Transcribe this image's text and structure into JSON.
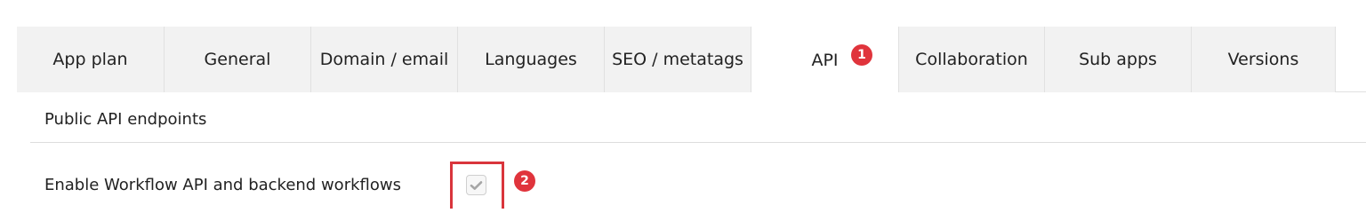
{
  "tabs": [
    {
      "label": "App plan",
      "active": false
    },
    {
      "label": "General",
      "active": false
    },
    {
      "label": "Domain / email",
      "active": false
    },
    {
      "label": "Languages",
      "active": false
    },
    {
      "label": "SEO / metatags",
      "active": false
    },
    {
      "label": "API",
      "active": true
    },
    {
      "label": "Collaboration",
      "active": false
    },
    {
      "label": "Sub apps",
      "active": false
    },
    {
      "label": "Versions",
      "active": false
    }
  ],
  "annotations": {
    "step1": "1",
    "step2": "2"
  },
  "section": {
    "title": "Public API endpoints"
  },
  "settings": {
    "workflow_api_label": "Enable Workflow API and backend workflows",
    "workflow_api_checked": true
  },
  "colors": {
    "tab_inactive_bg": "#f2f2f2",
    "tab_active_bg": "#ffffff",
    "annotation_red": "#e0343c",
    "checkmark_gray": "#a6a6a6"
  },
  "icons": {
    "checkbox": "checkmark-icon"
  }
}
